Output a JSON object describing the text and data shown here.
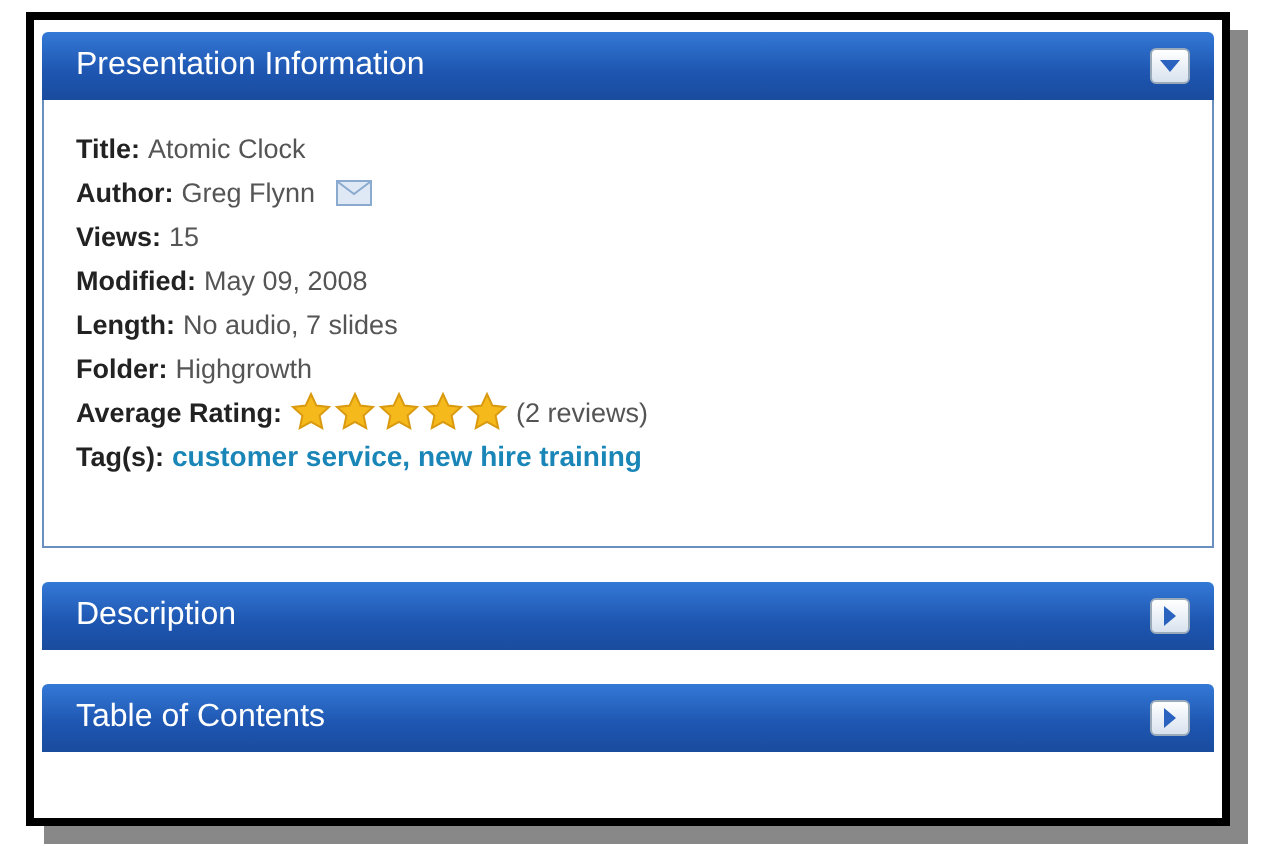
{
  "sections": [
    {
      "title": "Presentation Information",
      "expanded": true,
      "fields": [
        {
          "kind": "text",
          "label": "Title:",
          "value": "Atomic Clock"
        },
        {
          "kind": "email",
          "label": "Author:",
          "value": "Greg Flynn"
        },
        {
          "kind": "text",
          "label": "Views:",
          "value": "15"
        },
        {
          "kind": "text",
          "label": "Modified:",
          "value": "May 09, 2008"
        },
        {
          "kind": "text",
          "label": "Length:",
          "value": "No audio, 7 slides"
        },
        {
          "kind": "text",
          "label": "Folder:",
          "value": "Highgrowth"
        },
        {
          "kind": "rating",
          "label": "Average Rating:",
          "stars": 5,
          "value": "(2 reviews)"
        },
        {
          "kind": "tags",
          "label": "Tag(s):",
          "value": "customer service, new hire training"
        }
      ]
    },
    {
      "title": "Description",
      "expanded": false
    },
    {
      "title": "Table of Contents",
      "expanded": false
    }
  ]
}
